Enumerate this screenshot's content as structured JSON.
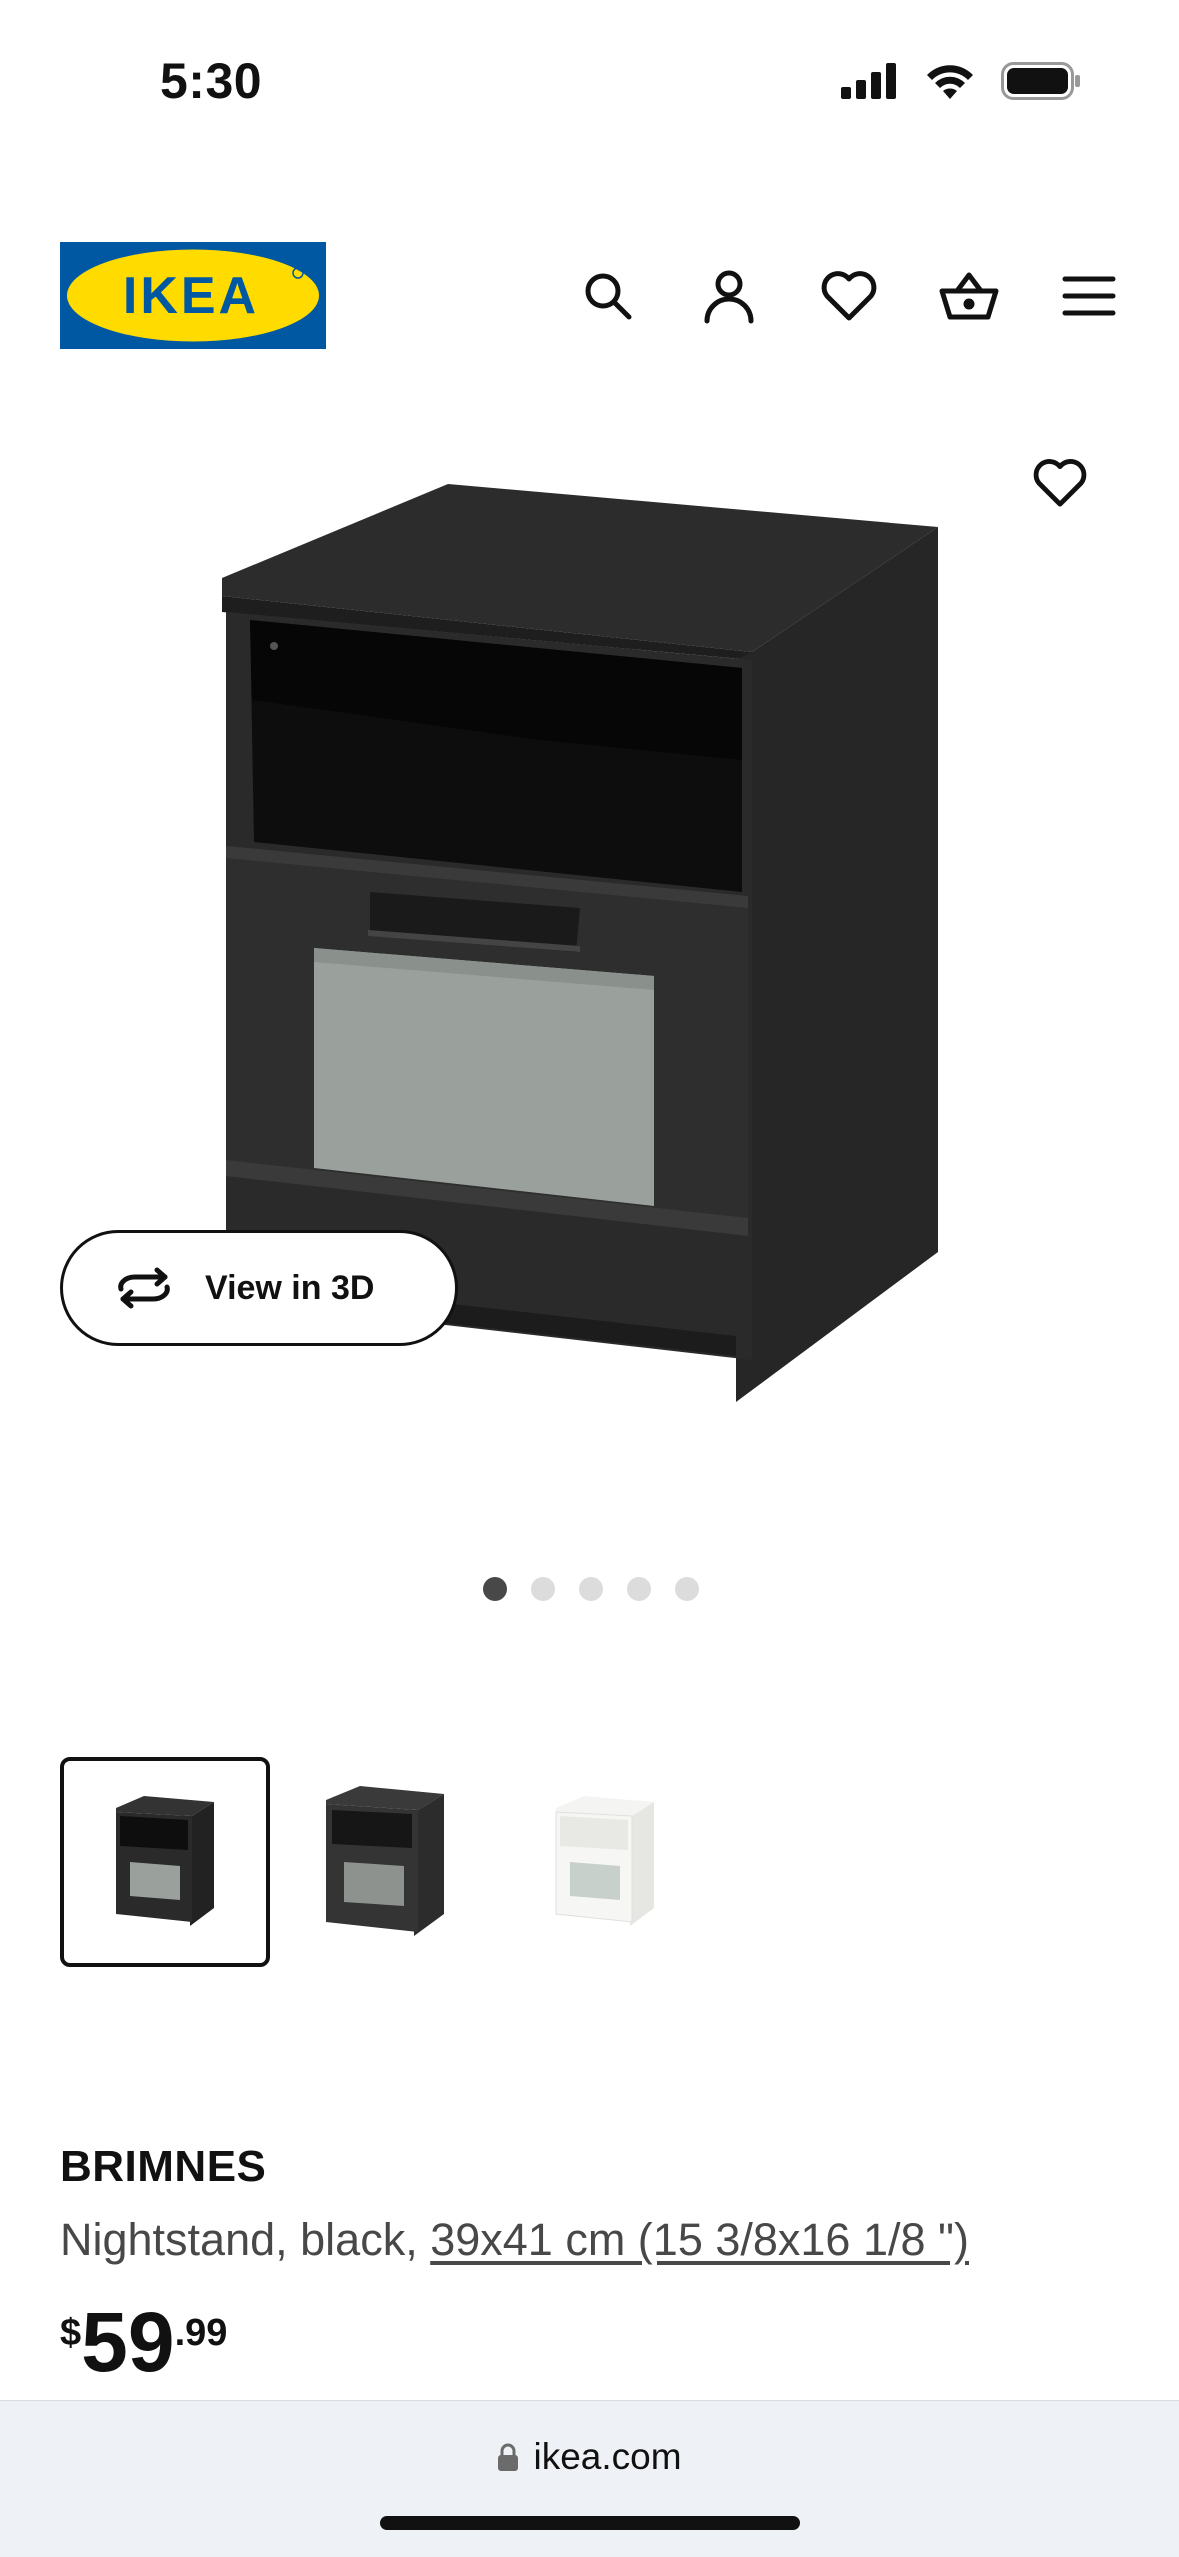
{
  "status_bar": {
    "time": "5:30"
  },
  "header": {
    "logo_text": "IKEA",
    "colors": {
      "brand_blue": "#0058a3",
      "brand_yellow": "#ffdb00"
    },
    "nav_icons": [
      "search-icon",
      "account-icon",
      "wishlist-heart-icon",
      "basket-icon",
      "menu-icon"
    ]
  },
  "gallery": {
    "view_3d_label": "View in 3D",
    "dots_total": 5,
    "active_dot_index": 0,
    "thumbnails": [
      "black",
      "black-brown",
      "white"
    ],
    "selected_thumbnail_index": 0
  },
  "product": {
    "name": "BRIMNES",
    "description_prefix": "Nightstand, black, ",
    "dimensions": "39x41 cm (15 3/8x16 1/8 \")",
    "price": {
      "currency": "$",
      "integer": "59",
      "decimal": ".99"
    }
  },
  "browser": {
    "url": "ikea.com"
  }
}
